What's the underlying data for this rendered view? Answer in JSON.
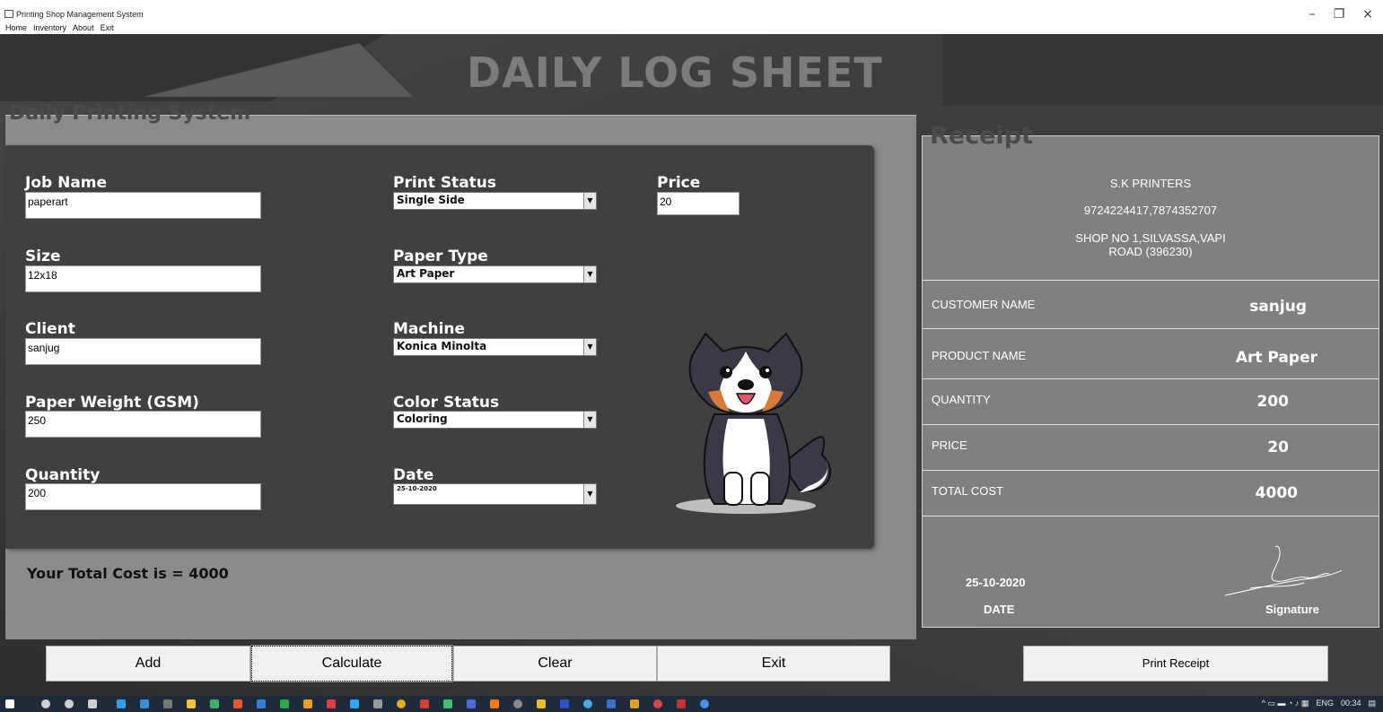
{
  "window": {
    "title": "Printing Shop Management System",
    "menu": [
      "Home",
      "Inventory",
      "About",
      "Exit"
    ],
    "controls": {
      "minimize": "–",
      "maximize": "❐",
      "close": "×"
    }
  },
  "header": {
    "title": "DAILY LOG SHEET"
  },
  "form": {
    "legend": "Daily Printing System",
    "job_name": {
      "label": "Job Name",
      "value": "paperart"
    },
    "size": {
      "label": "Size",
      "value": "12x18"
    },
    "client": {
      "label": "Client",
      "value": "sanjug"
    },
    "paper_weight": {
      "label": "Paper Weight (GSM)",
      "value": "250"
    },
    "quantity": {
      "label": "Quantity",
      "value": "200"
    },
    "print_status": {
      "label": "Print Status",
      "value": "Single Side"
    },
    "paper_type": {
      "label": "Paper Type",
      "value": "Art Paper"
    },
    "machine": {
      "label": "Machine",
      "value": "Konica Minolta"
    },
    "color_status": {
      "label": "Color Status",
      "value": "Coloring"
    },
    "date": {
      "label": "Date",
      "value": "25-10-2020"
    },
    "price": {
      "label": "Price",
      "value": "20"
    },
    "total_text": "Your Total Cost is = 4000"
  },
  "receipt": {
    "legend": "Receipt",
    "shop_name": "S.K PRINTERS",
    "phone": "9724224417,7874352707",
    "address_line1": "SHOP NO 1,SILVASSA,VAPI",
    "address_line2": "ROAD (396230)",
    "rows": [
      {
        "label": "CUSTOMER NAME",
        "value": "sanjug"
      },
      {
        "label": "PRODUCT NAME",
        "value": "Art Paper"
      },
      {
        "label": "QUANTITY",
        "value": "200"
      },
      {
        "label": "PRICE",
        "value": "20"
      },
      {
        "label": "TOTAL COST",
        "value": "4000"
      }
    ],
    "date_value": "25-10-2020",
    "date_label": "DATE",
    "signature_label": "Signature"
  },
  "buttons": {
    "add": "Add",
    "calculate": "Calculate",
    "clear": "Clear",
    "exit": "Exit",
    "print_receipt": "Print Receipt"
  },
  "taskbar": {
    "tray_lang": "ENG",
    "tray_time": "00:34"
  },
  "colors": {
    "background_dark": "#3e3e3e",
    "panel_gray": "#8a8a8a",
    "form_card": "#404040",
    "receipt_bg": "#808080",
    "taskbar": "#1f2a3a"
  }
}
